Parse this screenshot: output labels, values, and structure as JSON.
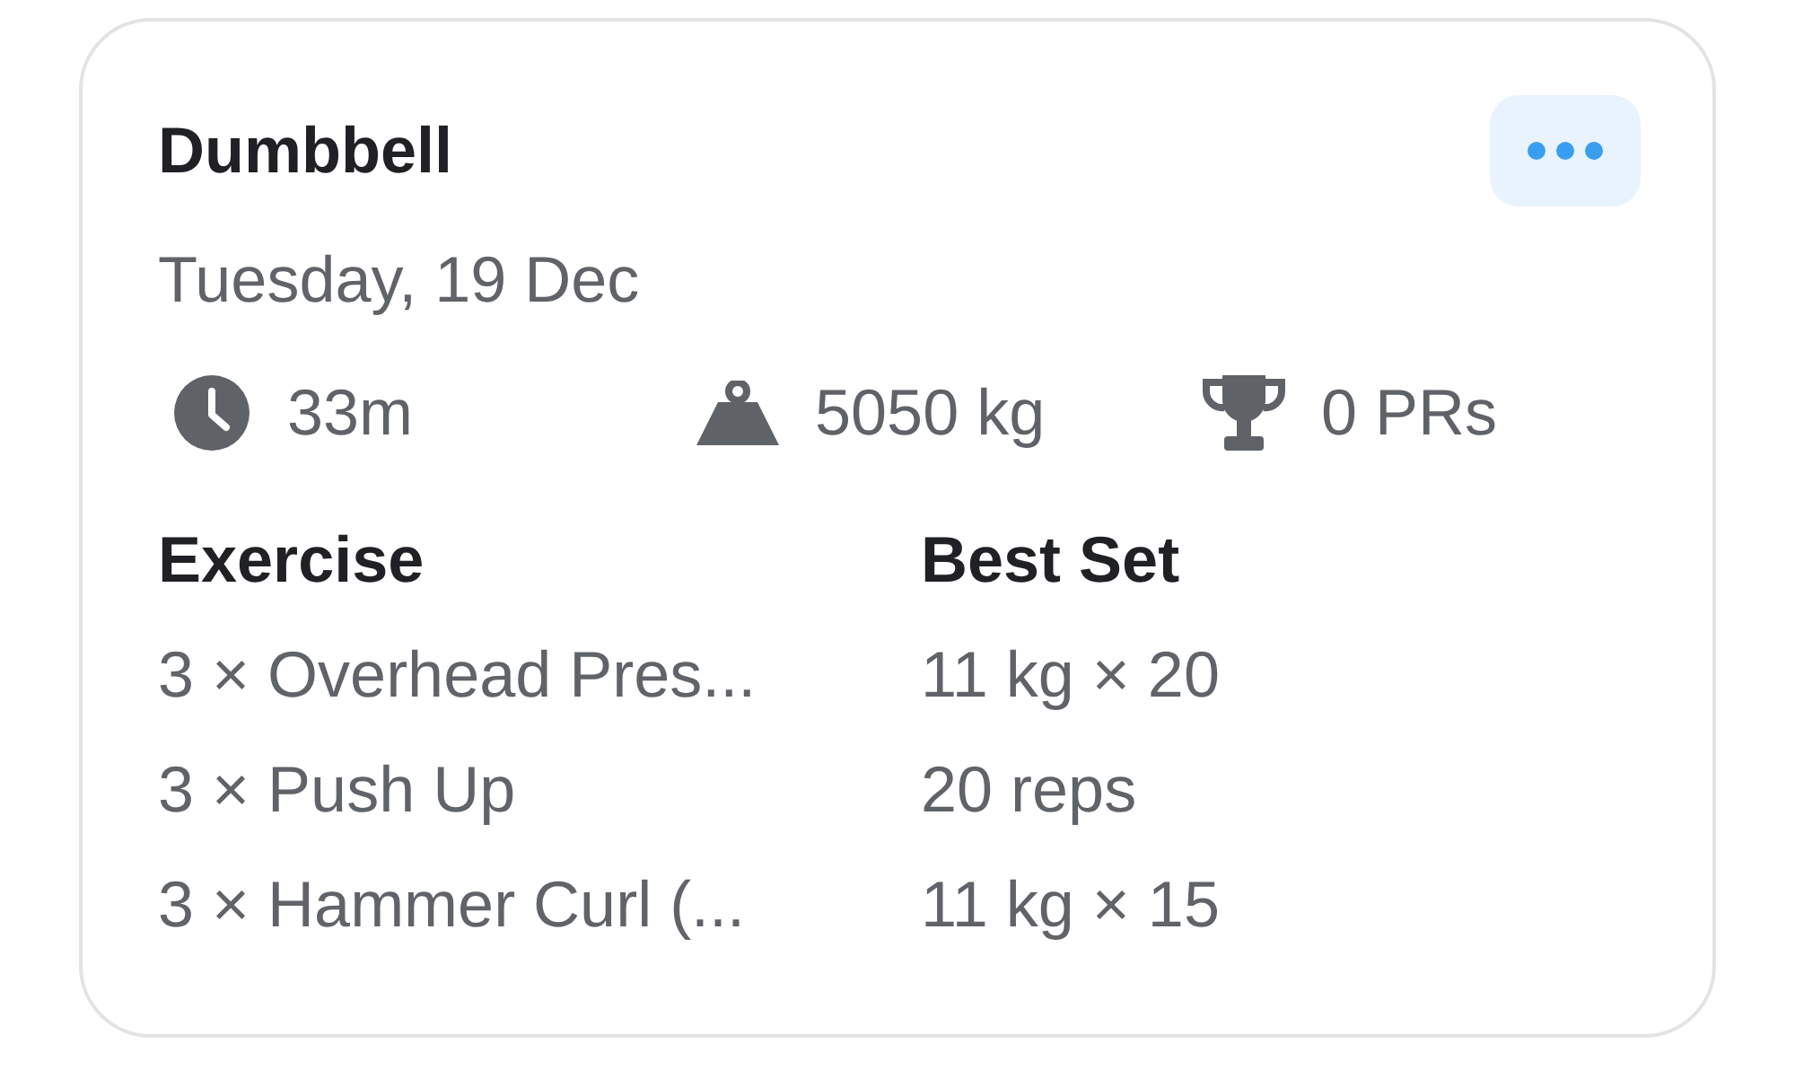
{
  "card": {
    "title": "Dumbbell",
    "date": "Tuesday, 19 Dec",
    "stats": [
      {
        "kind": "duration",
        "value": "33m"
      },
      {
        "kind": "volume",
        "value": "5050 kg"
      },
      {
        "kind": "records",
        "value": "0 PRs"
      }
    ],
    "table": {
      "columns": [
        "Exercise",
        "Best Set"
      ],
      "rows": [
        [
          "3 × Overhead Pres...",
          "11 kg × 20"
        ],
        [
          "3 × Push Up",
          "20 reps"
        ],
        [
          "3 × Hammer Curl (...",
          "11 kg × 15"
        ]
      ]
    }
  }
}
